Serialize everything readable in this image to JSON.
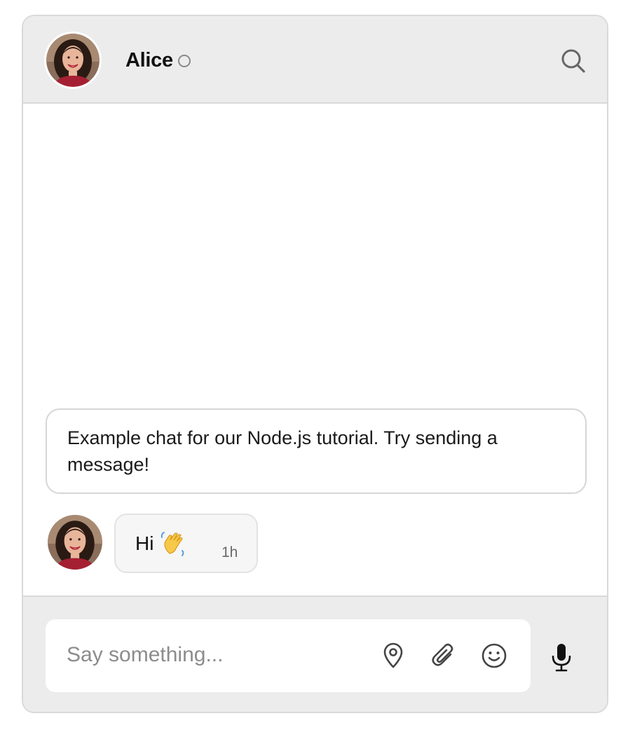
{
  "header": {
    "contact_name": "Alice",
    "status": "offline",
    "avatar_icon": "user-avatar",
    "search_icon": "search-icon"
  },
  "messages": {
    "system_note": "Example chat for our Node.js tutorial. Try sending a message!",
    "items": [
      {
        "text": "Hi",
        "emoji": "waving-hand-emoji",
        "time": "1h"
      }
    ]
  },
  "composer": {
    "placeholder": "Say something...",
    "value": "",
    "icons": [
      "location-pin-icon",
      "paperclip-icon",
      "smiley-icon",
      "microphone-icon"
    ]
  },
  "colors": {
    "header_bg": "#ececec",
    "border": "#d9d9d9",
    "bubble_bg": "#f6f6f6",
    "text": "#111111",
    "muted": "#6a6a6a"
  }
}
